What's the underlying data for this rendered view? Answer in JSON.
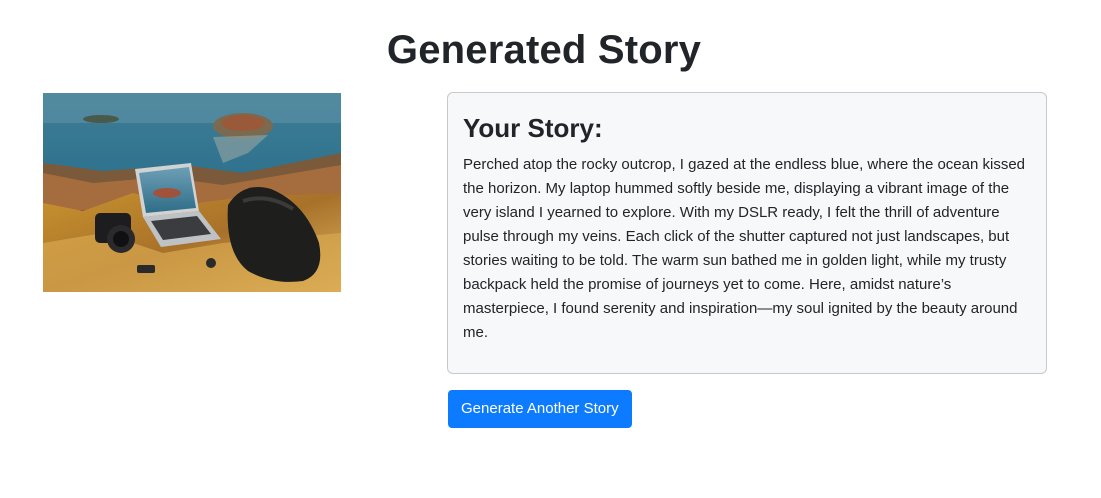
{
  "page": {
    "title": "Generated Story"
  },
  "image": {
    "description_icon": "photo-laptop-camera-backpack"
  },
  "story": {
    "heading": "Your Story:",
    "text": "Perched atop the rocky outcrop, I gazed at the endless blue, where the ocean kissed the horizon. My laptop hummed softly beside me, displaying a vibrant image of the very island I yearned to explore. With my DSLR ready, I felt the thrill of adventure pulse through my veins. Each click of the shutter captured not just landscapes, but stories waiting to be told. The warm sun bathed me in golden light, while my trusty backpack held the promise of journeys yet to come. Here, amidst nature’s masterpiece, I found serenity and inspiration—my soul ignited by the beauty around me."
  },
  "actions": {
    "generate_label": "Generate Another Story"
  },
  "colors": {
    "primary": "#0d7bff",
    "card_bg": "#f7f8f9",
    "card_border": "#c8c9cb",
    "text": "#212529"
  }
}
